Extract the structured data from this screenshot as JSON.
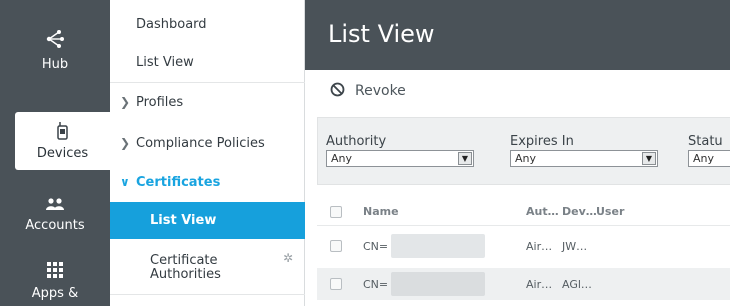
{
  "rail": {
    "items": [
      {
        "label": "Hub",
        "icon": "hub-icon"
      },
      {
        "label": "Devices",
        "icon": "mobile-phone-icon"
      },
      {
        "label": "Accounts",
        "icon": "users-icon"
      },
      {
        "label": "Apps &",
        "icon": "grid-icon"
      }
    ]
  },
  "subnav": {
    "dashboard": "Dashboard",
    "list_view": "List View",
    "profiles": "Profiles",
    "compliance": "Compliance Policies",
    "certificates": "Certificates",
    "cert_list_view": "List View",
    "cert_authorities": "Certificate Authorities"
  },
  "main": {
    "title": "List View",
    "toolbar": {
      "revoke": "Revoke"
    },
    "filters": [
      {
        "label": "Authority",
        "value": "Any"
      },
      {
        "label": "Expires In",
        "value": "Any"
      },
      {
        "label": "Statu",
        "value": "Any"
      }
    ],
    "table": {
      "headers": [
        "Name",
        "Aut…",
        "Dev…",
        "User"
      ],
      "rows": [
        {
          "name": "CN=",
          "aut": "Air…",
          "dev": "JW…",
          "user": ""
        },
        {
          "name": "CN=",
          "aut": "Air…",
          "dev": "AGl…",
          "user": ""
        }
      ]
    }
  },
  "colors": {
    "rail_bg": "#4a5258",
    "accent": "#16a0dc",
    "section_text": "#19a4e0",
    "title_bar": "#4a5258"
  }
}
